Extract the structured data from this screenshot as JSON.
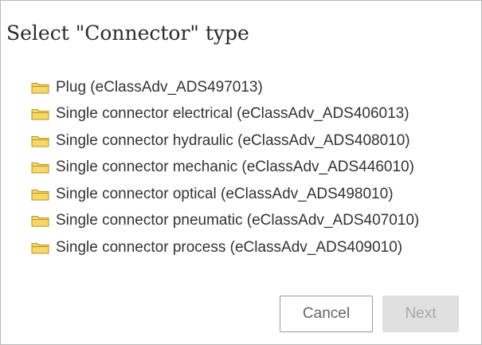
{
  "dialog": {
    "title": "Select \"Connector\" type",
    "items": [
      {
        "label": "Plug (eClassAdv_ADS497013)",
        "icon": "folder-icon"
      },
      {
        "label": "Single connector electrical (eClassAdv_ADS406013)",
        "icon": "folder-icon"
      },
      {
        "label": "Single connector hydraulic (eClassAdv_ADS408010)",
        "icon": "folder-icon"
      },
      {
        "label": "Single connector mechanic (eClassAdv_ADS446010)",
        "icon": "folder-icon"
      },
      {
        "label": "Single connector optical (eClassAdv_ADS498010)",
        "icon": "folder-icon"
      },
      {
        "label": "Single connector pneumatic (eClassAdv_ADS407010)",
        "icon": "folder-icon"
      },
      {
        "label": "Single connector process (eClassAdv_ADS409010)",
        "icon": "folder-icon"
      }
    ],
    "cancel_label": "Cancel",
    "next_label": "Next",
    "next_disabled": true
  },
  "colors": {
    "folder_fill": "#f5d76a",
    "folder_stroke": "#b8951a",
    "disabled_button_bg": "#e0e0e0"
  }
}
